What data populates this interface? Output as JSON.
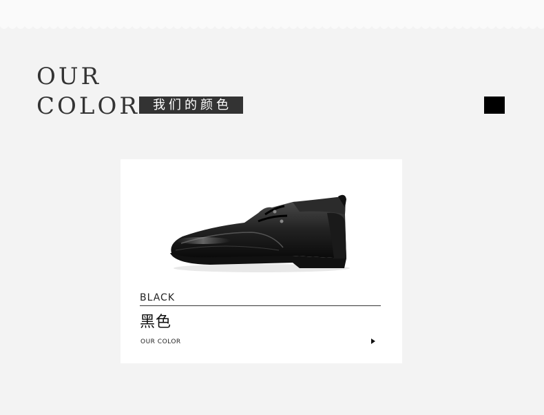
{
  "heading": {
    "line1": "OUR",
    "line2": "COLOR",
    "cn_tag": "我们的颜色"
  },
  "swatch": {
    "color": "#000000"
  },
  "product": {
    "image_icon": "black-leather-derby-shoe",
    "color_name_en": "BLACK",
    "color_name_cn": "黑色",
    "footer_label": "OUR COLOR",
    "arrow_icon": "play-triangle-right"
  },
  "colors": {
    "background": "#f3f3f3",
    "card": "#ffffff",
    "tag_bg": "#333333",
    "text": "#333333"
  }
}
